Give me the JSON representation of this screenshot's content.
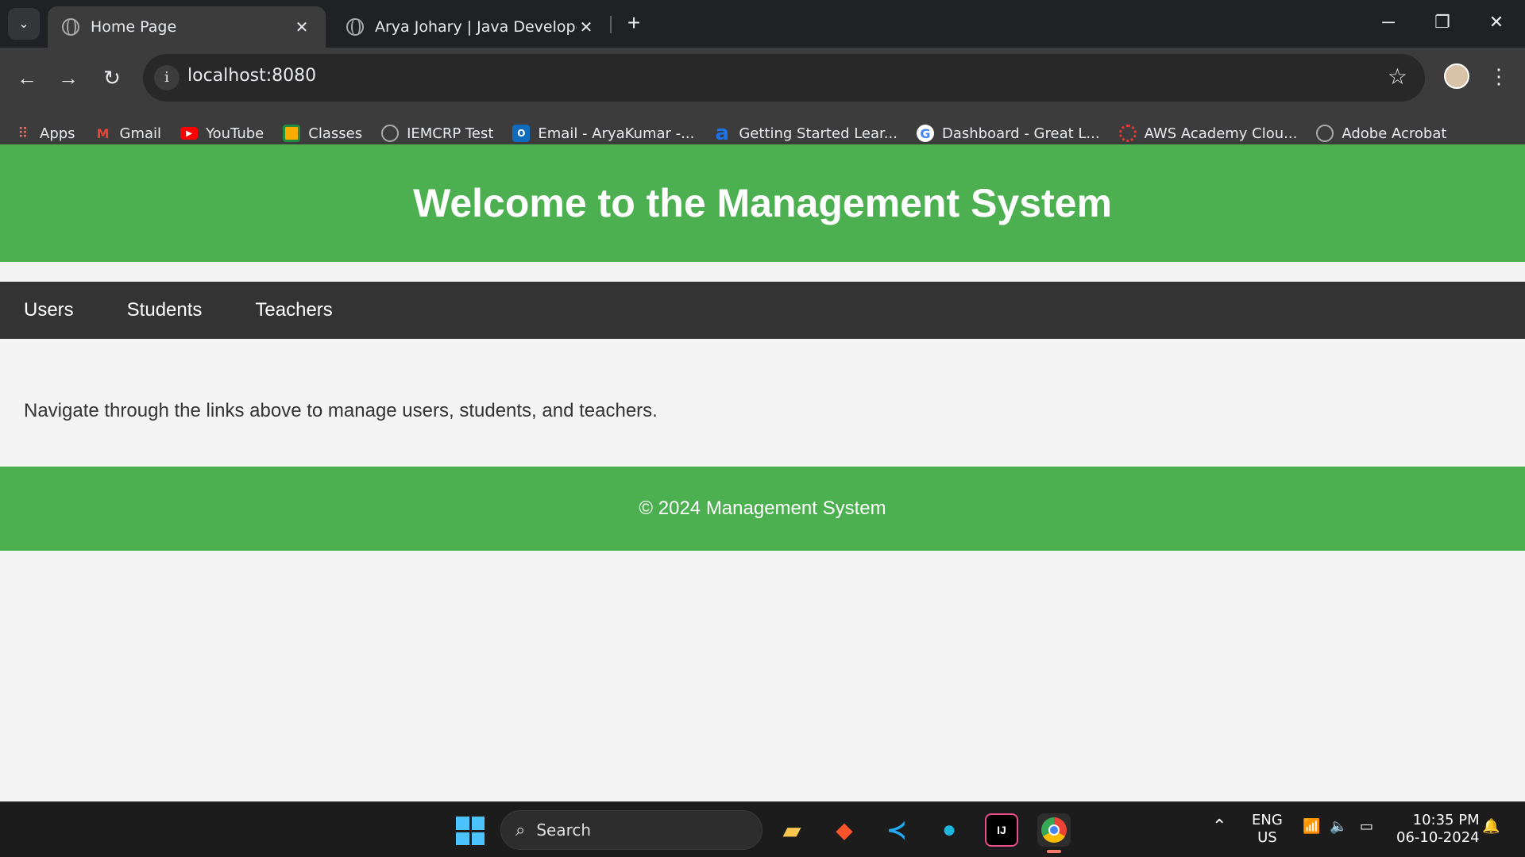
{
  "browser": {
    "tabs": [
      {
        "title": "Home Page",
        "active": true
      },
      {
        "title": "Arya Johary | Java Developer",
        "active": false
      }
    ],
    "url": "localhost:8080",
    "bookmarks": [
      {
        "label": "Apps",
        "icon": "apps-grid-icon"
      },
      {
        "label": "Gmail",
        "icon": "gmail-icon"
      },
      {
        "label": "YouTube",
        "icon": "youtube-icon"
      },
      {
        "label": "Classes",
        "icon": "classes-icon"
      },
      {
        "label": "IEMCRP Test",
        "icon": "globe-icon"
      },
      {
        "label": "Email - AryaKumar -...",
        "icon": "outlook-icon"
      },
      {
        "label": "Getting Started Lear...",
        "icon": "amazon-icon"
      },
      {
        "label": "Dashboard - Great L...",
        "icon": "google-icon"
      },
      {
        "label": "AWS Academy Clou...",
        "icon": "aws-icon"
      },
      {
        "label": "Adobe Acrobat",
        "icon": "globe-icon"
      }
    ]
  },
  "page": {
    "hero_title": "Welcome to the Management System",
    "nav": [
      "Users",
      "Students",
      "Teachers"
    ],
    "intro": "Navigate through the links above to manage users, students, and teachers.",
    "footer": "© 2024 Management System"
  },
  "taskbar": {
    "search_placeholder": "Search",
    "language": "ENG",
    "region": "US",
    "time": "10:35 PM",
    "date": "06-10-2024"
  },
  "colors": {
    "accent_green": "#4caf50",
    "nav_dark": "#333333"
  }
}
